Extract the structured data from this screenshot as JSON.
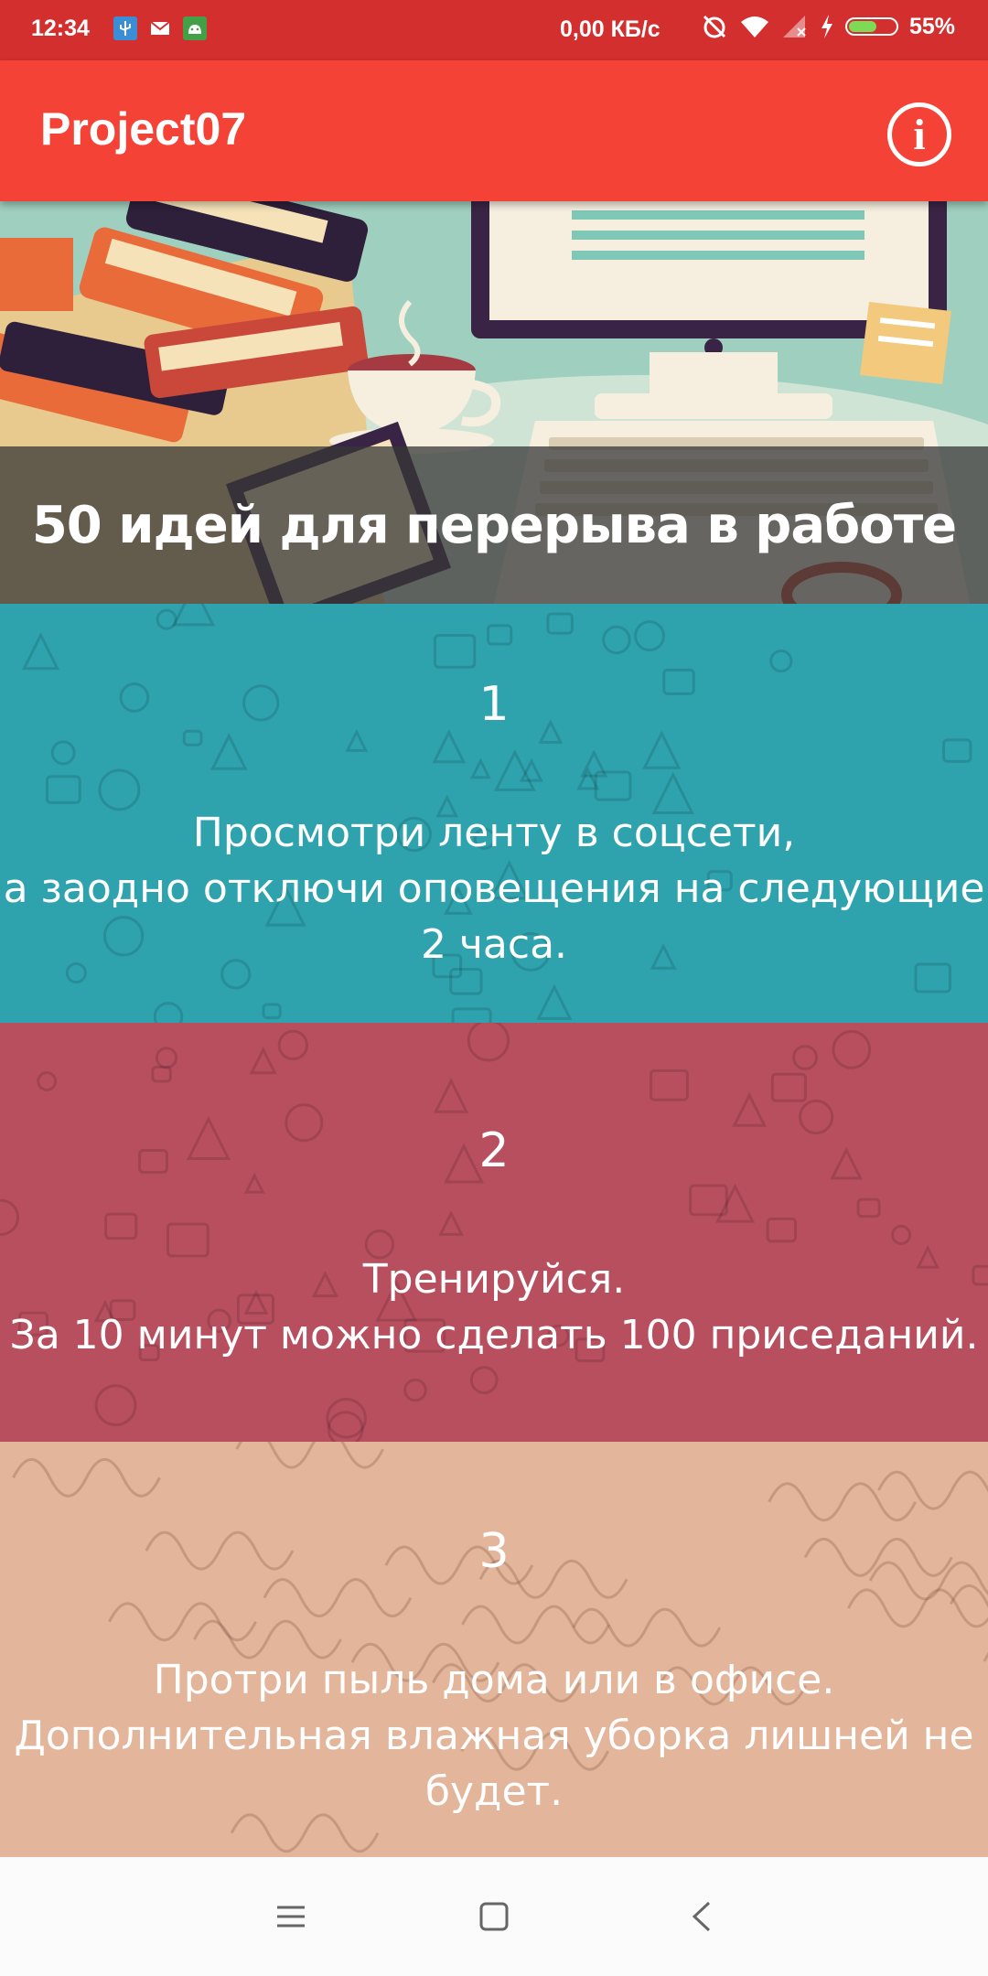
{
  "status_bar": {
    "time": "12:34",
    "speed": "0,00 КБ/с",
    "battery": "55%",
    "battery_level": 0.55,
    "notification_icons": [
      "usb-icon",
      "mail-icon",
      "android-icon"
    ],
    "system_icons": [
      "alarm-off-icon",
      "wifi-icon",
      "no-signal-icon",
      "charging-bolt-icon",
      "battery-icon"
    ]
  },
  "app_bar": {
    "title": "Project07",
    "info_glyph": "i"
  },
  "hero": {
    "headline": "50 идей для перерыва в работе"
  },
  "ideas": [
    {
      "number": "1",
      "lines": [
        "Просмотри ленту в соцсети,",
        "а заодно отключи оповещения на следующие",
        "2 часа."
      ],
      "color": "#2ea3ae"
    },
    {
      "number": "2",
      "lines": [
        "Тренируйся.",
        "За 10 минут можно сделать 100 приседаний."
      ],
      "color": "#b84f5f"
    },
    {
      "number": "3",
      "lines": [
        "Протри пыль дома или в офисе.",
        "Дополнительная влажная уборка лишней не",
        "будет."
      ],
      "color": "#e3b59a"
    }
  ],
  "nav_bar": {
    "icons": [
      "menu-icon",
      "home-square-icon",
      "back-icon"
    ]
  },
  "colors": {
    "status_bar": "#d32f2f",
    "app_bar": "#f44336",
    "nav_bar": "#fbfbfb"
  }
}
